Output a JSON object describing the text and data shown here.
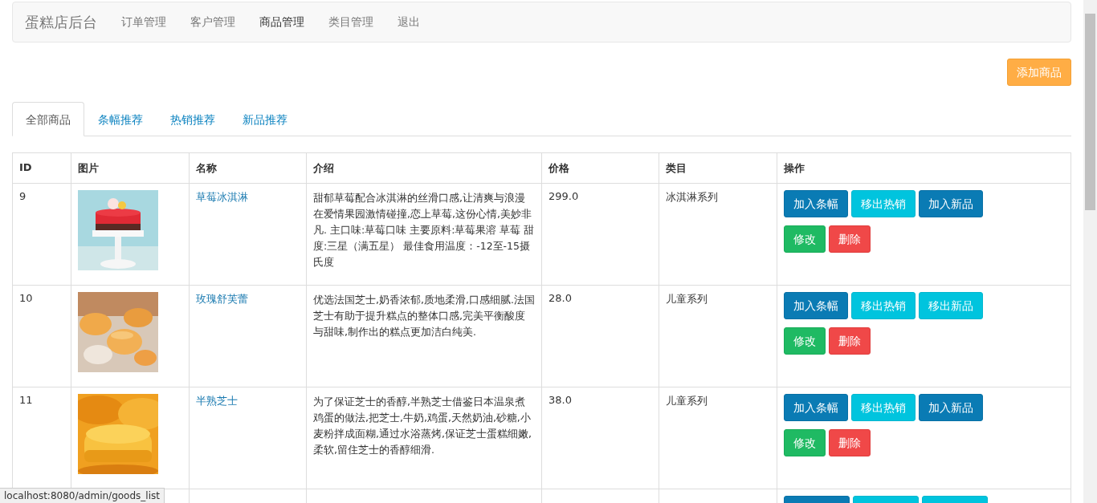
{
  "navbar": {
    "brand": "蛋糕店后台",
    "links": [
      {
        "label": "订单管理",
        "selected": false
      },
      {
        "label": "客户管理",
        "selected": false
      },
      {
        "label": "商品管理",
        "selected": true
      },
      {
        "label": "类目管理",
        "selected": false
      },
      {
        "label": "退出",
        "selected": false
      }
    ]
  },
  "add_button": "添加商品",
  "tabs": [
    {
      "label": "全部商品",
      "selected": true
    },
    {
      "label": "条幅推荐",
      "selected": false
    },
    {
      "label": "热销推荐",
      "selected": false
    },
    {
      "label": "新品推荐",
      "selected": false
    }
  ],
  "table": {
    "columns": [
      "ID",
      "图片",
      "名称",
      "介绍",
      "价格",
      "类目",
      "操作"
    ],
    "rows": [
      {
        "id": "9",
        "image": {
          "kind": "picture"
        },
        "name": "草莓冰淇淋",
        "description": "甜郁草莓配合冰淇淋的丝滑口感,让清爽与浪漫在爱情果园激情碰撞,恋上草莓,这份心情,美妙非凡. 主口味:草莓口味 主要原料:草莓果溶 草莓 甜度:三星（满五星） 最佳食用温度：-12至-15摄氏度",
        "price": "299.0",
        "category": "冰淇淋系列",
        "actions": [
          {
            "label": "加入条幅",
            "kind": "primary"
          },
          {
            "label": "移出热销",
            "kind": "info"
          },
          {
            "label": "加入新品",
            "kind": "primary"
          }
        ],
        "edit": "修改",
        "delete": "删除"
      },
      {
        "id": "10",
        "image": {
          "kind": "picture"
        },
        "name": "玫瑰舒芙蕾",
        "description": "优选法国芝士,奶香浓郁,质地柔滑,口感细腻.法国芝士有助于提升糕点的整体口感,完美平衡酸度与甜味,制作出的糕点更加洁白纯美.",
        "price": "28.0",
        "category": "儿童系列",
        "actions": [
          {
            "label": "加入条幅",
            "kind": "primary"
          },
          {
            "label": "移出热销",
            "kind": "info"
          },
          {
            "label": "移出新品",
            "kind": "info"
          }
        ],
        "edit": "修改",
        "delete": "删除"
      },
      {
        "id": "11",
        "image": {
          "kind": "picture"
        },
        "name": "半熟芝士",
        "description": "为了保证芝士的香醇,半熟芝士借鉴日本温泉煮鸡蛋的做法,把芝士,牛奶,鸡蛋,天然奶油,砂糖,小麦粉拌成面糊,通过水浴蒸烤,保证芝士蛋糕细嫩,柔软,留住芝士的香醇细滑.",
        "price": "38.0",
        "category": "儿童系列",
        "actions": [
          {
            "label": "加入条幅",
            "kind": "primary"
          },
          {
            "label": "移出热销",
            "kind": "info"
          },
          {
            "label": "加入新品",
            "kind": "primary"
          }
        ],
        "edit": "修改",
        "delete": "删除"
      },
      {
        "actions": [
          {
            "kind": "primary"
          },
          {
            "kind": "info"
          },
          {
            "kind": "info"
          }
        ]
      }
    ]
  },
  "status_url": "localhost:8080/admin/goods_list"
}
